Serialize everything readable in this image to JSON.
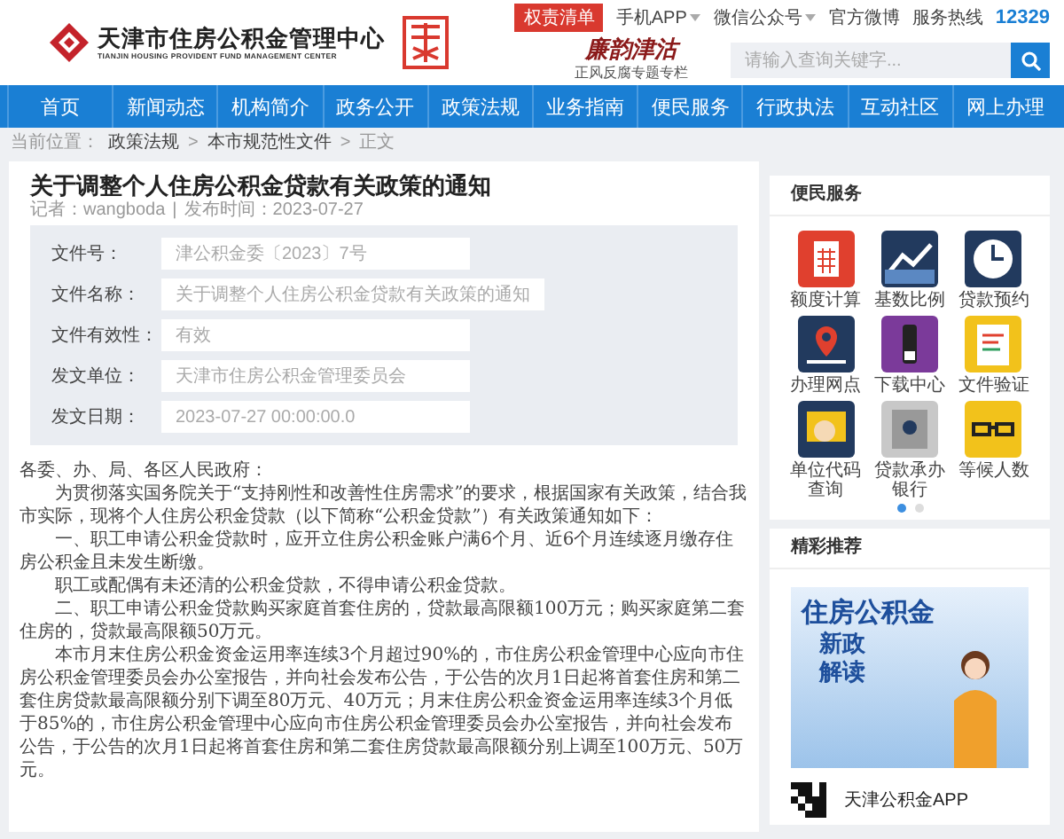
{
  "header": {
    "title": "天津市住房公积金管理中心",
    "subtitle": "TIANJIN HOUSING PROVIDENT FUND MANAGEMENT CENTER",
    "top_links": [
      {
        "kind": "badge",
        "label": "权责清单"
      },
      {
        "kind": "dropdown",
        "label": "手机APP"
      },
      {
        "kind": "dropdown",
        "label": "微信公众号"
      },
      {
        "kind": "link",
        "label": "官方微博"
      },
      {
        "kind": "link",
        "label": "服务热线"
      },
      {
        "kind": "hotline",
        "label": "12329"
      }
    ],
    "column_logo": {
      "title": "廉韵津沽",
      "subtitle": "正风反腐专题专栏"
    },
    "search": {
      "placeholder": "请输入查询关键字..."
    }
  },
  "nav": [
    "首页",
    "新闻动态",
    "机构简介",
    "政务公开",
    "政策法规",
    "业务指南",
    "便民服务",
    "行政执法",
    "互动社区",
    "网上办理"
  ],
  "breadcrumb": {
    "prefix": "当前位置：",
    "separator": ">",
    "items": [
      "政策法规",
      "本市规范性文件",
      "正文"
    ]
  },
  "article": {
    "title": "关于调整个人住房公积金贷款有关政策的通知",
    "author": "记者：wangboda",
    "meta_separator": "|",
    "date": "发布时间：2023-07-27",
    "fields": [
      {
        "label": "文件号：",
        "value": "津公积金委〔2023〕7号"
      },
      {
        "label": "文件名称：",
        "value": "关于调整个人住房公积金贷款有关政策的通知"
      },
      {
        "label": "文件有效性：",
        "value": "有效"
      },
      {
        "label": "发文单位：",
        "value": "天津市住房公积金管理委员会"
      },
      {
        "label": "发文日期：",
        "value": "2023-07-27 00:00:00.0"
      }
    ],
    "paragraphs": [
      {
        "kind": "salutation",
        "text": "各委、办、局、各区人民政府："
      },
      {
        "kind": "body",
        "text": "为贯彻落实国务院关于“支持刚性和改善性住房需求”的要求，根据国家有关政策，结合我市实际，现将个人住房公积金贷款（以下简称“公积金贷款”）有关政策通知如下："
      },
      {
        "kind": "body",
        "text": "一、职工申请公积金贷款时，应开立住房公积金账户满6个月、近6个月连续逐月缴存住房公积金且未发生断缴。"
      },
      {
        "kind": "body",
        "text": "职工或配偶有未还清的公积金贷款，不得申请公积金贷款。"
      },
      {
        "kind": "body",
        "text": "二、职工申请公积金贷款购买家庭首套住房的，贷款最高限额100万元；购买家庭第二套住房的，贷款最高限额50万元。"
      },
      {
        "kind": "body",
        "text": "本市月末住房公积金资金运用率连续3个月超过90%的，市住房公积金管理中心应向市住房公积金管理委员会办公室报告，并向社会发布公告，于公告的次月1日起将首套住房和第二套住房贷款最高限额分别下调至80万元、40万元；月末住房公积金资金运用率连续3个月低于85%的，市住房公积金管理中心应向市住房公积金管理委员会办公室报告，并向社会发布公告，于公告的次月1日起将首套住房和第二套住房贷款最高限额分别上调至100万元、50万元。"
      }
    ]
  },
  "services": {
    "title": "便民服务",
    "items": [
      {
        "label": "额度计算",
        "color": "#e0402e"
      },
      {
        "label": "基数比例",
        "color": "#223a5e"
      },
      {
        "label": "贷款预约",
        "color": "#223a5e"
      },
      {
        "label": "办理网点",
        "color": "#223a5e"
      },
      {
        "label": "下载中心",
        "color": "#7b3a9a"
      },
      {
        "label": "文件验证",
        "color": "#f2c21b"
      },
      {
        "label": "单位代码查询",
        "color": "#223a5e"
      },
      {
        "label": "贷款承办银行",
        "color": "#c8c8c8"
      },
      {
        "label": "等候人数",
        "color": "#f2c21b"
      }
    ],
    "dots": [
      {
        "selected": true
      },
      {
        "selected": false
      }
    ]
  },
  "recommend": {
    "title": "精彩推荐",
    "banner_lines": [
      "住房公积金",
      "新政",
      "解读"
    ],
    "app_label": "天津公积金APP"
  }
}
